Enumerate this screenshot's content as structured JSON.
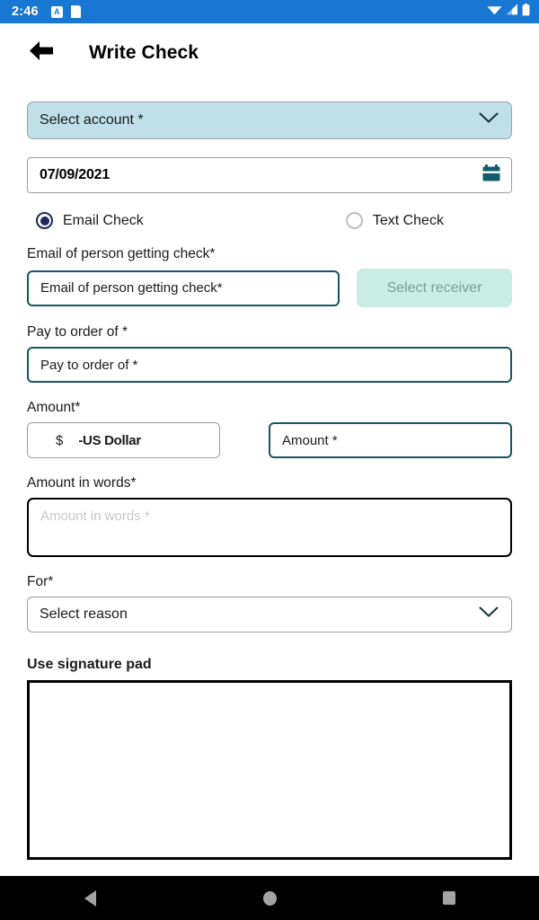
{
  "status_bar": {
    "time": "2:46",
    "left_icons": [
      "app-badge-icon",
      "sd-card-icon"
    ],
    "app_badge_letter": "A",
    "right_icons": [
      "wifi-icon",
      "cellular-signal-icon",
      "battery-icon"
    ],
    "background_color": "#1877d2"
  },
  "app_bar": {
    "back_icon": "back-arrow-icon",
    "title": "Write Check"
  },
  "form": {
    "account": {
      "label": "Select account *",
      "background_color": "#bfdfe9",
      "icon": "chevron-down-icon"
    },
    "date": {
      "value": "07/09/2021",
      "icon": "calendar-icon",
      "icon_color": "#135d6e"
    },
    "delivery": {
      "options": [
        {
          "label": "Email Check",
          "selected": true
        },
        {
          "label": "Text Check",
          "selected": false
        }
      ],
      "selected_color": "#1b2a59"
    },
    "email": {
      "label": "Email of person getting check*",
      "placeholder": "Email of person getting check*",
      "value": "",
      "receiver_button": "Select receiver",
      "receiver_button_color": "#c9ece4",
      "receiver_button_enabled": false
    },
    "pay_to": {
      "label": "Pay to order of *",
      "placeholder": "Pay to order of *",
      "value": ""
    },
    "amount": {
      "label": "Amount*",
      "currency_symbol": "$",
      "currency_name": "-US Dollar",
      "placeholder": "Amount *",
      "value": ""
    },
    "amount_words": {
      "label": "Amount in words*",
      "placeholder": "Amount in words *",
      "value": ""
    },
    "reason": {
      "label": "For*",
      "value": "Select reason",
      "icon": "chevron-down-icon"
    },
    "signature": {
      "label": "Use signature pad"
    }
  },
  "nav_bar": {
    "buttons": [
      "back-nav-icon",
      "home-nav-icon",
      "recents-nav-icon"
    ],
    "background_color": "#000000"
  }
}
